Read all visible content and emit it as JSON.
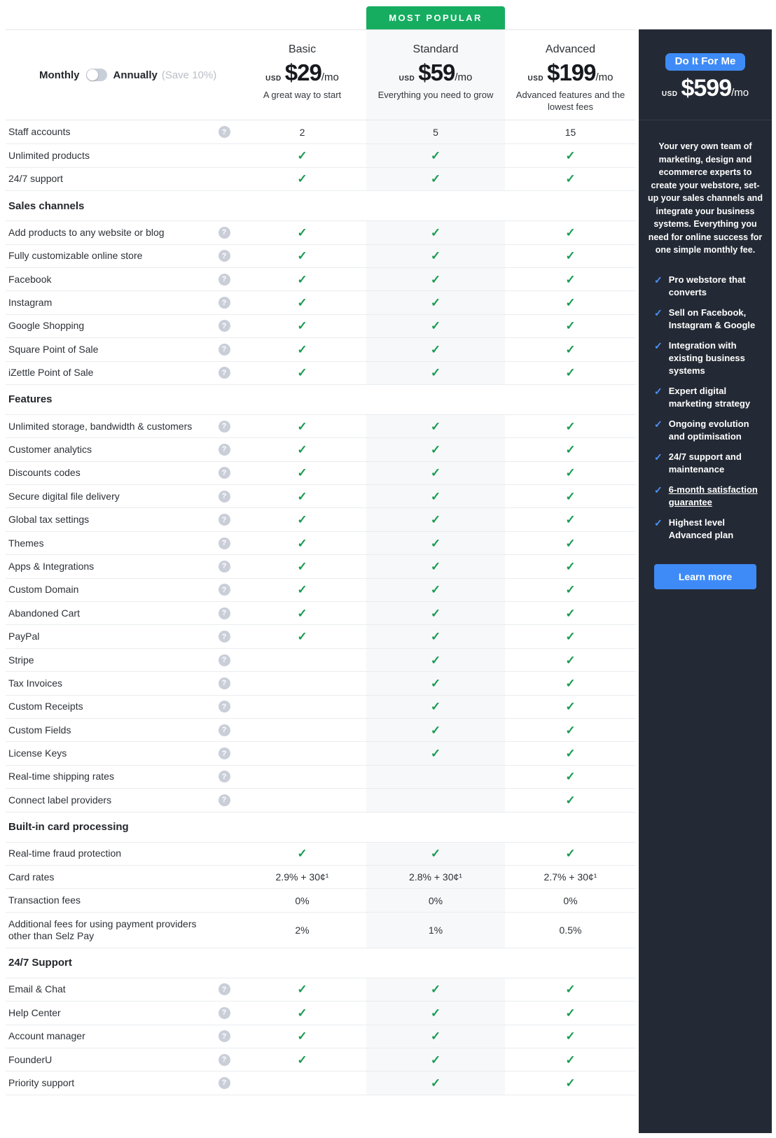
{
  "badge": "MOST POPULAR",
  "billing": {
    "monthly": "Monthly",
    "annually": "Annually",
    "save_note": "(Save 10%)"
  },
  "plans": [
    {
      "name": "Basic",
      "currency": "USD",
      "price": "$29",
      "period": "/mo",
      "tagline": "A great way to start"
    },
    {
      "name": "Standard",
      "currency": "USD",
      "price": "$59",
      "period": "/mo",
      "tagline": "Everything you need to grow"
    },
    {
      "name": "Advanced",
      "currency": "USD",
      "price": "$199",
      "period": "/mo",
      "tagline": "Advanced features and the lowest fees"
    }
  ],
  "table": {
    "sections": [
      {
        "header": "",
        "rows": [
          {
            "label": "Staff accounts",
            "help": true,
            "values": [
              "2",
              "5",
              "15"
            ]
          },
          {
            "label": "Unlimited products",
            "help": false,
            "values": [
              "check",
              "check",
              "check"
            ]
          },
          {
            "label": "24/7 support",
            "help": false,
            "values": [
              "check",
              "check",
              "check"
            ]
          }
        ]
      },
      {
        "header": "Sales channels",
        "rows": [
          {
            "label": "Add products to any website or blog",
            "help": true,
            "values": [
              "check",
              "check",
              "check"
            ]
          },
          {
            "label": "Fully customizable online store",
            "help": true,
            "values": [
              "check",
              "check",
              "check"
            ]
          },
          {
            "label": "Facebook",
            "help": true,
            "values": [
              "check",
              "check",
              "check"
            ]
          },
          {
            "label": "Instagram",
            "help": true,
            "values": [
              "check",
              "check",
              "check"
            ]
          },
          {
            "label": "Google Shopping",
            "help": true,
            "values": [
              "check",
              "check",
              "check"
            ]
          },
          {
            "label": "Square Point of Sale",
            "help": true,
            "values": [
              "check",
              "check",
              "check"
            ]
          },
          {
            "label": "iZettle Point of Sale",
            "help": true,
            "values": [
              "check",
              "check",
              "check"
            ]
          }
        ]
      },
      {
        "header": "Features",
        "rows": [
          {
            "label": "Unlimited storage, bandwidth & customers",
            "help": true,
            "values": [
              "check",
              "check",
              "check"
            ]
          },
          {
            "label": "Customer analytics",
            "help": true,
            "values": [
              "check",
              "check",
              "check"
            ]
          },
          {
            "label": "Discounts codes",
            "help": true,
            "values": [
              "check",
              "check",
              "check"
            ]
          },
          {
            "label": "Secure digital file delivery",
            "help": true,
            "values": [
              "check",
              "check",
              "check"
            ]
          },
          {
            "label": "Global tax settings",
            "help": true,
            "values": [
              "check",
              "check",
              "check"
            ]
          },
          {
            "label": "Themes",
            "help": true,
            "values": [
              "check",
              "check",
              "check"
            ]
          },
          {
            "label": "Apps & Integrations",
            "help": true,
            "values": [
              "check",
              "check",
              "check"
            ]
          },
          {
            "label": "Custom Domain",
            "help": true,
            "values": [
              "check",
              "check",
              "check"
            ]
          },
          {
            "label": "Abandoned Cart",
            "help": true,
            "values": [
              "check",
              "check",
              "check"
            ]
          },
          {
            "label": "PayPal",
            "help": true,
            "values": [
              "check",
              "check",
              "check"
            ]
          },
          {
            "label": "Stripe",
            "help": true,
            "values": [
              "",
              "check",
              "check"
            ]
          },
          {
            "label": "Tax Invoices",
            "help": true,
            "values": [
              "",
              "check",
              "check"
            ]
          },
          {
            "label": "Custom Receipts",
            "help": true,
            "values": [
              "",
              "check",
              "check"
            ]
          },
          {
            "label": "Custom Fields",
            "help": true,
            "values": [
              "",
              "check",
              "check"
            ]
          },
          {
            "label": "License Keys",
            "help": true,
            "values": [
              "",
              "check",
              "check"
            ]
          },
          {
            "label": "Real-time shipping rates",
            "help": true,
            "values": [
              "",
              "",
              "check"
            ]
          },
          {
            "label": "Connect label providers",
            "help": true,
            "values": [
              "",
              "",
              "check"
            ]
          }
        ]
      },
      {
        "header": "Built-in card processing",
        "rows": [
          {
            "label": "Real-time fraud protection",
            "help": false,
            "values": [
              "check",
              "check",
              "check"
            ]
          },
          {
            "label": "Card rates",
            "help": false,
            "values": [
              "2.9% + 30¢¹",
              "2.8% + 30¢¹",
              "2.7% + 30¢¹"
            ]
          },
          {
            "label": "Transaction fees",
            "help": false,
            "values": [
              "0%",
              "0%",
              "0%"
            ]
          },
          {
            "label": "Additional fees for using payment providers other than Selz Pay",
            "help": false,
            "tall": true,
            "values": [
              "2%",
              "1%",
              "0.5%"
            ]
          }
        ]
      },
      {
        "header": "24/7 Support",
        "rows": [
          {
            "label": "Email & Chat",
            "help": true,
            "values": [
              "check",
              "check",
              "check"
            ]
          },
          {
            "label": "Help Center",
            "help": true,
            "values": [
              "check",
              "check",
              "check"
            ]
          },
          {
            "label": "Account manager",
            "help": true,
            "values": [
              "check",
              "check",
              "check"
            ]
          },
          {
            "label": "FounderU",
            "help": true,
            "values": [
              "check",
              "check",
              "check"
            ]
          },
          {
            "label": "Priority support",
            "help": true,
            "values": [
              "",
              "check",
              "check"
            ]
          }
        ]
      }
    ]
  },
  "sidebar": {
    "cta_button": "Do It For Me",
    "currency": "USD",
    "price": "$599",
    "period": "/mo",
    "description": "Your very own team of marketing, design and ecommerce experts to create your webstore, set-up your sales channels and integrate your business systems. Everything you need for online success for one simple monthly fee.",
    "bullets": [
      {
        "text": "Pro webstore that converts",
        "underline": false
      },
      {
        "text": "Sell on Facebook, Instagram & Google",
        "underline": false
      },
      {
        "text": "Integration with existing business systems",
        "underline": false
      },
      {
        "text": "Expert digital marketing strategy",
        "underline": false
      },
      {
        "text": "Ongoing evolution and optimisation",
        "underline": false
      },
      {
        "text": "24/7 support and maintenance",
        "underline": false
      },
      {
        "text": "6-month satisfaction guarantee",
        "underline": true
      },
      {
        "text": "Highest level Advanced plan",
        "underline": false
      }
    ],
    "learn_more": "Learn more"
  },
  "colors": {
    "badge_green": "#16ad60",
    "check_green": "#189b52",
    "sidebar_bg": "#242a35",
    "button_blue": "#3e8bf7"
  }
}
